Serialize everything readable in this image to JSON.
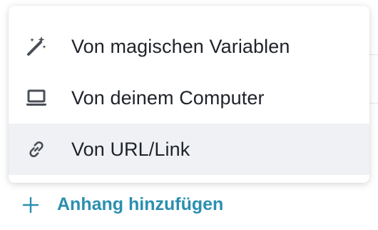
{
  "menu": {
    "items": [
      {
        "label": "Von magischen Variablen",
        "icon": "magic-wand-icon"
      },
      {
        "label": "Von deinem Computer",
        "icon": "laptop-icon"
      },
      {
        "label": "Von URL/Link",
        "icon": "link-icon",
        "highlighted": true
      }
    ]
  },
  "footer": {
    "add_label": "Anhang hinzufügen",
    "icon": "plus-icon"
  },
  "colors": {
    "accent": "#2b8fb0",
    "text": "#1f2329",
    "icon": "#4a4f57",
    "highlight": "#eff1f4"
  }
}
